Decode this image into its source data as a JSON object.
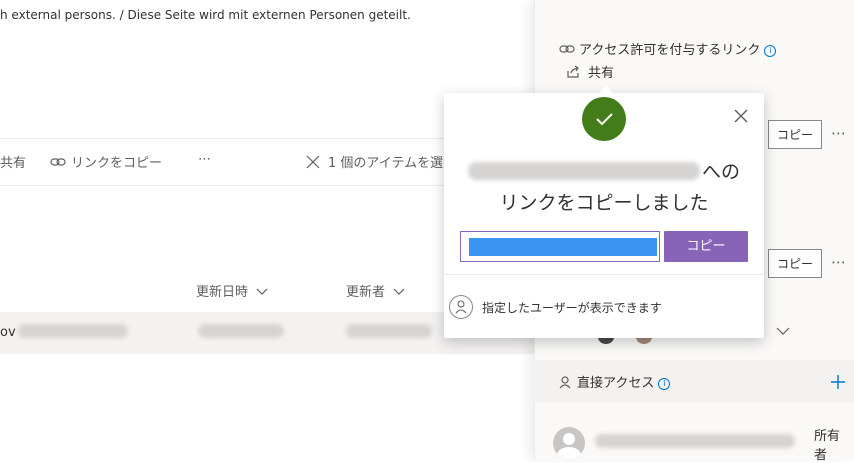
{
  "banner": {
    "text": "h external persons. / Diese Seite wird mit externen Personen geteilt."
  },
  "toolbar": {
    "share_label": "共有",
    "copy_link_label": "リンクをコピー",
    "more_label": "⋯",
    "selected_label": "1 個のアイテムを選"
  },
  "list": {
    "columns": [
      "更新日時",
      "更新者"
    ],
    "row_prefix": "ov"
  },
  "panel": {
    "link_section_title": "アクセス許可を付与するリンク",
    "share_label": "共有",
    "copy_label": "コピー",
    "more_label": "⋯",
    "direct_access_title": "直接アクセス",
    "owner_label_1": "所有",
    "owner_label_2": "者"
  },
  "popup": {
    "title_suffix": "への",
    "title_line2": "リンクをコピーしました",
    "copy_button": "コピー",
    "footer_text": "指定したユーザーが表示できます"
  },
  "colors": {
    "accent_purple": "#8764b8",
    "success_green": "#437d1a",
    "link_blue": "#0078d4"
  }
}
